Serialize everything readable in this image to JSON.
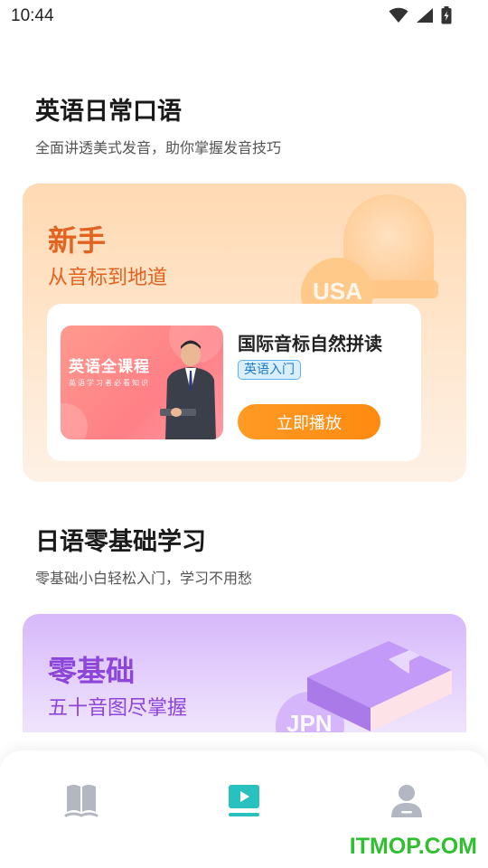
{
  "status": {
    "time": "10:44"
  },
  "english_section": {
    "title": "英语日常口语",
    "subtitle": "全面讲透美式发音，助你掌握发音技巧",
    "card": {
      "heading": "新手",
      "subheading": "从音标到地道",
      "badge_text": "USA",
      "course": {
        "thumb_title": "英语全课程",
        "thumb_subtitle": "英语学习者必看知识",
        "name": "国际音标自然拼读",
        "tag": "英语入门",
        "play_label": "立即播放"
      }
    }
  },
  "japanese_section": {
    "title": "日语零基础学习",
    "subtitle": "零基础小白轻松入门，学习不用愁",
    "card": {
      "heading": "零基础",
      "subheading": "五十音图尽掌握",
      "badge_text": "JPN"
    }
  },
  "bottom_nav": {
    "items": [
      {
        "icon": "book-icon",
        "active": false
      },
      {
        "icon": "video-play-icon",
        "active": true
      },
      {
        "icon": "user-icon",
        "active": false
      }
    ]
  },
  "colors": {
    "accent_teal": "#28c1c0",
    "nav_inactive": "#b3b7c2",
    "orange": "#ff8a10",
    "purple": "#8c46d9"
  },
  "watermark": "ITMOP.COM"
}
